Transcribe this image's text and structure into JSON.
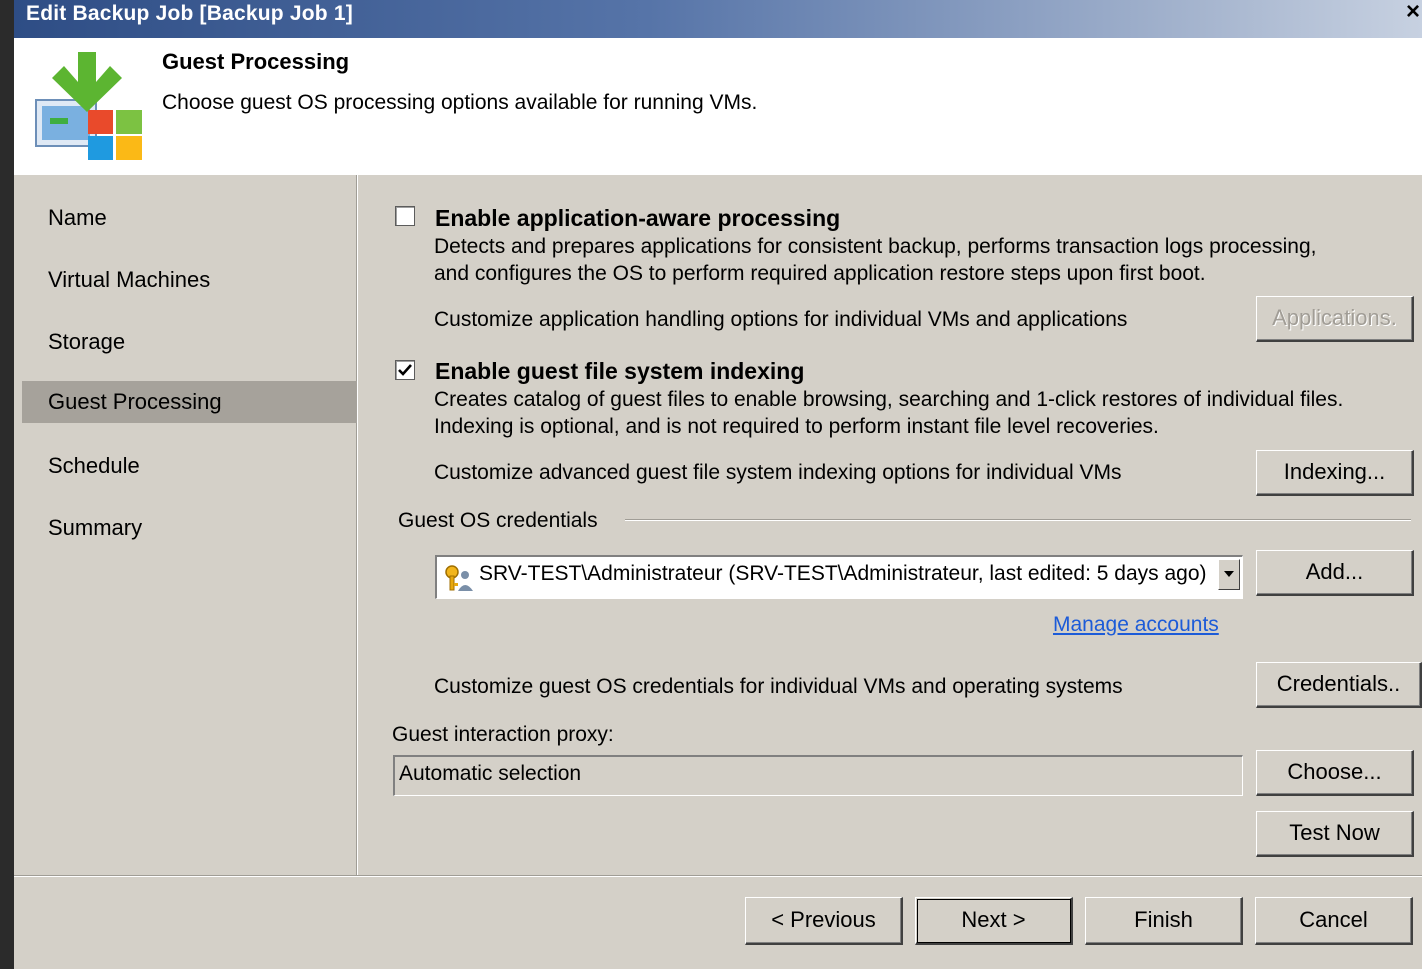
{
  "window": {
    "title": "Edit Backup Job [Backup Job 1]",
    "close_glyph": "×"
  },
  "header": {
    "title": "Guest Processing",
    "description": "Choose guest OS processing options available for running VMs.",
    "logo_icon": "guest-processing-logo-icon"
  },
  "sidebar": {
    "items": [
      {
        "label": "Name",
        "active": false
      },
      {
        "label": "Virtual Machines",
        "active": false
      },
      {
        "label": "Storage",
        "active": false
      },
      {
        "label": "Guest Processing",
        "active": true
      },
      {
        "label": "Schedule",
        "active": false
      },
      {
        "label": "Summary",
        "active": false
      }
    ]
  },
  "app_aware": {
    "checked": false,
    "title": "Enable application-aware processing",
    "desc_line1": "Detects and prepares applications for consistent backup, performs transaction logs processing,",
    "desc_line2": "and configures the OS to perform required application restore steps upon first boot.",
    "customize_text": "Customize application handling options for individual VMs and applications",
    "button_label": "Applications.",
    "button_enabled": false
  },
  "indexing": {
    "checked": true,
    "title": "Enable guest file system indexing",
    "desc_line1": "Creates catalog of guest files to enable browsing, searching and 1-click restores of individual files.",
    "desc_line2": "Indexing is optional, and is not required to perform instant file level recoveries.",
    "customize_text": "Customize advanced guest file system indexing options for individual VMs",
    "button_label": "Indexing..."
  },
  "credentials": {
    "group_label": "Guest OS credentials",
    "selected": "SRV-TEST\\Administrateur (SRV-TEST\\Administrateur, last edited: 5 days ago)",
    "add_label": "Add...",
    "manage_link": "Manage accounts",
    "customize_text": "Customize guest OS credentials for individual VMs and operating systems",
    "credentials_button": "Credentials.."
  },
  "proxy": {
    "label": "Guest interaction proxy:",
    "value": "Automatic selection",
    "choose_label": "Choose...",
    "test_label": "Test Now"
  },
  "footer": {
    "previous": "< Previous",
    "next": "Next >",
    "finish": "Finish",
    "cancel": "Cancel"
  },
  "colors": {
    "titlebar_start": "#2e4d85",
    "dialog_bg": "#d4d0c8",
    "selected_nav": "#a6a29b",
    "link": "#1c5bd8"
  }
}
